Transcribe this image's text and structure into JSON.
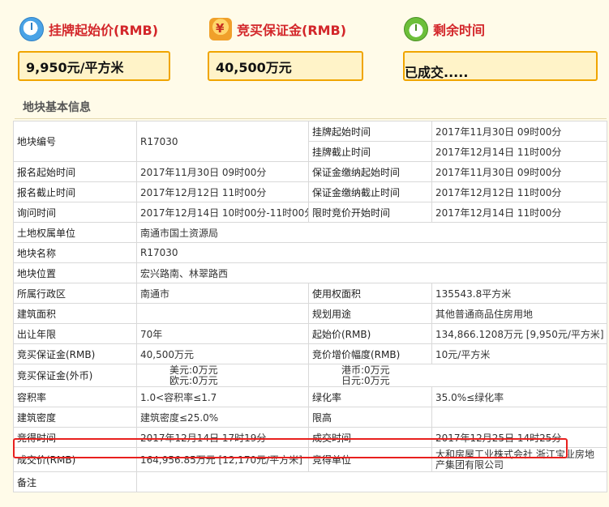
{
  "header": {
    "start_price_label": "挂牌起始价(RMB)",
    "deposit_label": "竞买保证金(RMB)",
    "remaining_label": "剩余时间",
    "start_price_value": "9,950元/平方米",
    "deposit_value": "40,500万元",
    "remaining_value": "已成交....."
  },
  "section_title": "地块基本信息",
  "table": {
    "plot_no_label": "地块编号",
    "plot_no": "R17030",
    "list_start_label": "挂牌起始时间",
    "list_start": "2017年11月30日 09时00分",
    "list_end_label": "挂牌截止时间",
    "list_end": "2017年12月14日 11时00分",
    "reg_start_label": "报名起始时间",
    "reg_start": "2017年11月30日 09时00分",
    "dep_start_label": "保证金缴纳起始时间",
    "dep_start": "2017年11月30日 09时00分",
    "reg_end_label": "报名截止时间",
    "reg_end": "2017年12月12日 11时00分",
    "dep_end_label": "保证金缴纳截止时间",
    "dep_end": "2017年12月12日 11时00分",
    "inquiry_label": "询问时间",
    "inquiry": "2017年12月14日 10时00分-11时00分",
    "bid_start_label": "限时竞价开始时间",
    "bid_start": "2017年12月14日 11时00分",
    "owner_label": "土地权属单位",
    "owner": "南通市国土资源局",
    "name_label": "地块名称",
    "name": "R17030",
    "location_label": "地块位置",
    "location": "宏兴路南、林翠路西",
    "district_label": "所属行政区",
    "district": "南通市",
    "use_area_label": "使用权面积",
    "use_area": "135543.8平方米",
    "build_area_label": "建筑面积",
    "build_area": "",
    "purpose_label": "规划用途",
    "purpose": "其他普通商品住房用地",
    "years_label": "出让年限",
    "years": "70年",
    "start_price_label": "起始价(RMB)",
    "start_price": "134,866.1208万元 [9,950元/平方米]",
    "deposit_rmb_label": "竞买保证金(RMB)",
    "deposit_rmb": "40,500万元",
    "increment_label": "竞价增价幅度(RMB)",
    "increment": "10元/平方米",
    "deposit_fx_label": "竞买保证金(外币)",
    "usd": "美元:0万元",
    "eur": "欧元:0万元",
    "hkd": "港币:0万元",
    "jpy": "日元:0万元",
    "far_label": "容积率",
    "far": "1.0<容积率≤1.7",
    "green_label": "绿化率",
    "green": "35.0%≤绿化率",
    "density_label": "建筑密度",
    "density": "建筑密度≤25.0%",
    "height_label": "限高",
    "height": "",
    "win_time_label": "竞得时间",
    "win_time": "2017年12月14日 17时19分",
    "deal_time_label": "成交时间",
    "deal_time": "2017年12月25日 14时25分",
    "deal_price_label": "成交价(RMB)",
    "deal_price": "164,956.85万元 [12,170元/平方米]",
    "winner_label": "竞得单位",
    "winner": "大和房屋工业株式会社 浙江宝业房地产集团有限公司",
    "remark_label": "备注",
    "remark": ""
  }
}
